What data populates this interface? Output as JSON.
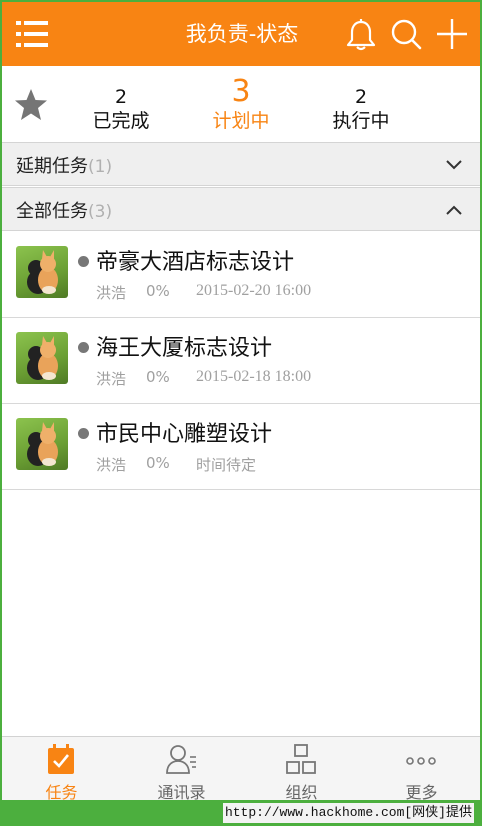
{
  "header": {
    "title": "我负责-状态",
    "icons": [
      "menu-icon",
      "bell-icon",
      "search-icon",
      "plus-icon"
    ],
    "bg_color": "#f88413"
  },
  "status": {
    "stats": [
      {
        "count": "2",
        "label": "已完成"
      },
      {
        "count": "3",
        "label": "计划中",
        "active": true
      },
      {
        "count": "2",
        "label": "执行中"
      }
    ],
    "accent_color": "#f88413"
  },
  "groups": {
    "delayed": {
      "label": "延期任务",
      "count": "(1)",
      "state": "collapsed"
    },
    "all": {
      "label": "全部任务",
      "count": "(3)",
      "state": "expanded"
    }
  },
  "tasks": [
    {
      "title": "帝豪大酒店标志设计",
      "owner": "洪浩",
      "progress": "0%",
      "due": "2015-02-20 16:00"
    },
    {
      "title": "海王大厦标志设计",
      "owner": "洪浩",
      "progress": "0%",
      "due": "2015-02-18 18:00"
    },
    {
      "title": "市民中心雕塑设计",
      "owner": "洪浩",
      "progress": "0%",
      "due": "时间待定"
    }
  ],
  "bottom_nav": {
    "items": [
      {
        "label": "任务",
        "icon": "task-icon",
        "active": true
      },
      {
        "label": "通讯录",
        "icon": "contacts-icon"
      },
      {
        "label": "组织",
        "icon": "org-icon"
      },
      {
        "label": "更多",
        "icon": "more-icon"
      }
    ]
  },
  "watermark": "http://www.hackhome.com[网侠]提供"
}
